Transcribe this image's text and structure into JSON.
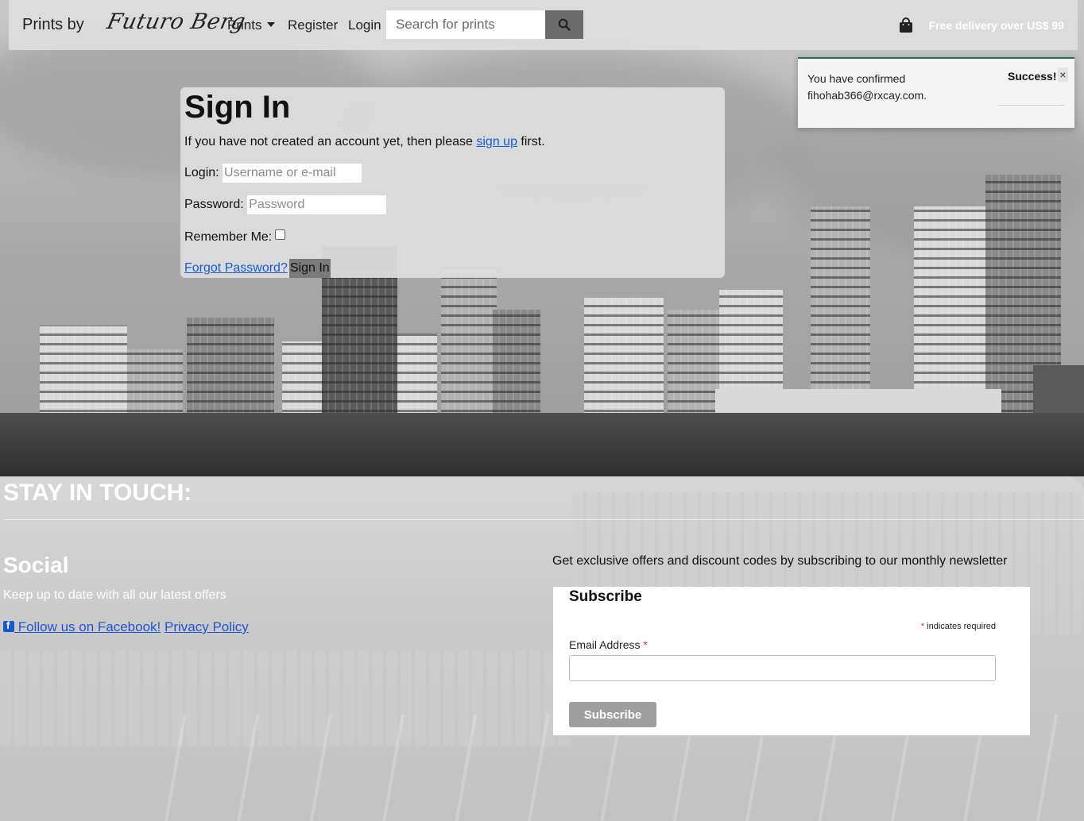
{
  "navbar": {
    "brand_text": "Prints by",
    "logo_text": "Futuro Berg",
    "links": [
      {
        "label": "Prints"
      },
      {
        "label": "Register"
      },
      {
        "label": "Login"
      }
    ],
    "search_placeholder": "Search for prints",
    "search_icon": "search-icon",
    "cart_icon": "shopping-bag-icon",
    "delivery_text": "Free delivery over US$ 99"
  },
  "toast": {
    "message": "You have confirmed fihohab366@rxcay.com.",
    "title": "Success!",
    "close_label": "×",
    "accent_color": "#2e6b4b"
  },
  "signin": {
    "heading": "Sign In",
    "intro_prefix": "If you have not created an account yet, then please",
    "intro_link": "sign up",
    "intro_suffix": "first.",
    "login_label": "Login:",
    "login_placeholder": "Username or e-mail",
    "password_label": "Password:",
    "password_placeholder": "Password",
    "remember_label": "Remember Me:",
    "forgot_link": "Forgot Password?",
    "submit_label": "Sign In"
  },
  "footer": {
    "stay_heading": "STAY IN TOUCH:",
    "social_heading": "Social",
    "social_text": "Keep up to date with all our latest offers",
    "facebook_link": " Follow us on Facebook!",
    "privacy_link": "Privacy Policy",
    "newsletter_text": "Get exclusive offers and discount codes by subscribing to our monthly newsletter",
    "subscribe": {
      "heading": "Subscribe",
      "required_note": "indicates required",
      "required_mark": "*",
      "email_label": "Email Address",
      "button_label": "Subscribe"
    }
  },
  "colors": {
    "link": "#1a57d6",
    "required": "#d12c2c"
  }
}
